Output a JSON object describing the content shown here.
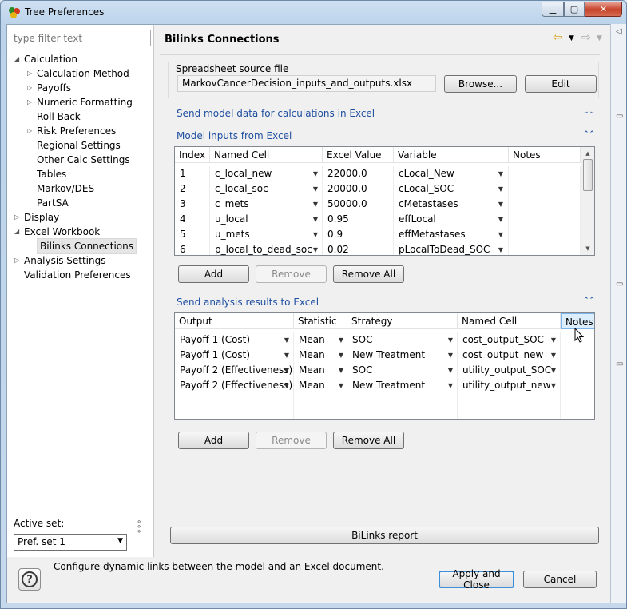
{
  "window": {
    "title": "Tree Preferences"
  },
  "left": {
    "filter_placeholder": "type filter text",
    "tree": [
      {
        "label": "Calculation",
        "expand": "open"
      },
      {
        "label": "Calculation Method",
        "expand": "closed"
      },
      {
        "label": "Payoffs",
        "expand": "closed"
      },
      {
        "label": "Numeric Formatting",
        "expand": "closed"
      },
      {
        "label": "Roll Back",
        "expand": "none"
      },
      {
        "label": "Risk Preferences",
        "expand": "closed"
      },
      {
        "label": "Regional Settings",
        "expand": "none"
      },
      {
        "label": "Other Calc Settings",
        "expand": "none"
      },
      {
        "label": "Tables",
        "expand": "none"
      },
      {
        "label": "Markov/DES",
        "expand": "none"
      },
      {
        "label": "PartSA",
        "expand": "none"
      },
      {
        "label": "Display",
        "expand": "closed"
      },
      {
        "label": "Excel Workbook",
        "expand": "open"
      },
      {
        "label": "Bilinks Connections",
        "expand": "none",
        "selected": true
      },
      {
        "label": "Analysis Settings",
        "expand": "closed"
      },
      {
        "label": "Validation Preferences",
        "expand": "none"
      }
    ],
    "active_set_label": "Active set:",
    "active_set_value": "Pref. set 1"
  },
  "page": {
    "title": "Bilinks Connections",
    "source_label": "Spreadsheet source file",
    "source_value": "MarkovCancerDecision_inputs_and_outputs.xlsx",
    "browse": "Browse...",
    "edit": "Edit",
    "send_model": "Send model data for calculations in Excel",
    "inputs_title": "Model inputs from Excel",
    "inputs_headers": [
      "Index",
      "Named Cell",
      "Excel Value",
      "Variable",
      "Notes"
    ],
    "inputs_rows": [
      [
        "1",
        "c_local_new",
        "22000.0",
        "cLocal_New",
        ""
      ],
      [
        "2",
        "c_local_soc",
        "20000.0",
        "cLocal_SOC",
        ""
      ],
      [
        "3",
        "c_mets",
        "50000.0",
        "cMetastases",
        ""
      ],
      [
        "4",
        "u_local",
        "0.95",
        "effLocal",
        ""
      ],
      [
        "5",
        "u_mets",
        "0.9",
        "effMetastases",
        ""
      ],
      [
        "6",
        "p_local_to_dead_soc",
        "0.02",
        "pLocalToDead_SOC",
        ""
      ]
    ],
    "add": "Add",
    "remove": "Remove",
    "remove_all": "Remove All",
    "outputs_title": "Send analysis results to Excel",
    "outputs_headers": [
      "Output",
      "Statistic",
      "Strategy",
      "Named Cell",
      "Notes"
    ],
    "outputs_rows": [
      [
        "Payoff 1 (Cost)",
        "Mean",
        "SOC",
        "cost_output_SOC",
        ""
      ],
      [
        "Payoff 1 (Cost)",
        "Mean",
        "New Treatment",
        "cost_output_new",
        ""
      ],
      [
        "Payoff 2 (Effectiveness)",
        "Mean",
        "SOC",
        "utility_output_SOC",
        ""
      ],
      [
        "Payoff 2 (Effectiveness)",
        "Mean",
        "New Treatment",
        "utility_output_new",
        ""
      ]
    ],
    "report": "BiLinks report"
  },
  "footer": {
    "description": "Configure dynamic links between the model and an Excel document.",
    "apply": "Apply and Close",
    "cancel": "Cancel"
  }
}
